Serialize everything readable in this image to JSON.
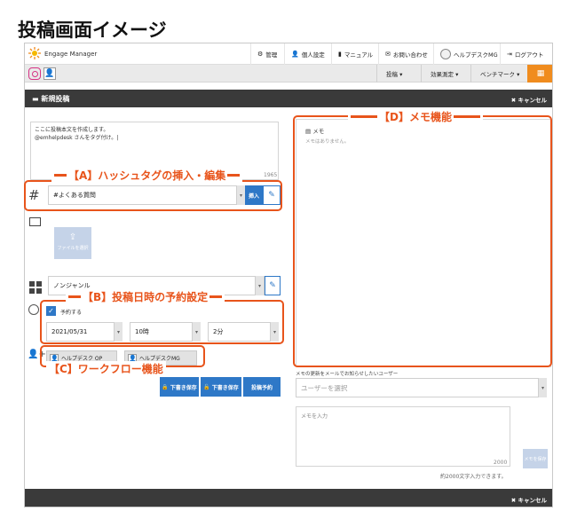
{
  "page_title": "投稿画面イメージ",
  "app": {
    "name": "Engage Manager"
  },
  "topnav": [
    {
      "icon": "gear-icon",
      "glyph": "⚙",
      "label": "管理"
    },
    {
      "icon": "person-icon",
      "glyph": "👤",
      "label": "個人設定"
    },
    {
      "icon": "book-icon",
      "glyph": "▮",
      "label": "マニュアル"
    },
    {
      "icon": "mail-icon",
      "glyph": "✉",
      "label": "お問い合わせ"
    },
    {
      "icon": "avatar-icon",
      "glyph": "",
      "label": "ヘルプデスクMG"
    },
    {
      "icon": "logout-icon",
      "glyph": "⇥",
      "label": "ログアウト"
    }
  ],
  "subnav": [
    "投稿 ▾",
    "効果測定 ▾",
    "ベンチマーク ▾"
  ],
  "header": {
    "title": "新規投稿",
    "cancel": "キャンセル"
  },
  "post": {
    "body_lines": [
      "ここに投稿本文を作成します。",
      "@emhelpdesk さんをタグ付け。|"
    ],
    "char_count": "1965"
  },
  "hashtag": {
    "value": "#よくある質問",
    "insert_label": "挿入"
  },
  "file_button": "ファイルを選択",
  "genre": {
    "value": "ノンジャンル"
  },
  "schedule": {
    "checkbox_label": "予約する",
    "checked": true,
    "date": "2021/05/31",
    "hour": "10時",
    "minute": "2分"
  },
  "workflow": [
    "ヘルプデスク OP",
    "ヘルプデスクMG"
  ],
  "actions": {
    "draft_save_1": "下書き保存",
    "draft_save_2": "下書き保存",
    "schedule_post": "投稿予約"
  },
  "memo": {
    "title": "メモ",
    "empty": "メモはありません。",
    "notify_label": "メモの更新をメールでお知らせしたいユーザー",
    "user_placeholder": "ユーザーを選択",
    "input_placeholder": "メモを入力",
    "char_limit": "2000",
    "save_label": "メモを保存",
    "hint": "約2000文字入力できます。"
  },
  "footer": {
    "cancel": "キャンセル"
  },
  "annotations": {
    "a": "【A】ハッシュタグの挿入・編集",
    "b": "【B】投稿日時の予約設定",
    "c": "【C】ワークフロー機能",
    "d": "【D】メモ機能"
  },
  "colors": {
    "accent_orange": "#e8541b",
    "primary_blue": "#2e78c7",
    "grid_button": "#f08c1e",
    "dark_bar": "#3a3a3a"
  }
}
